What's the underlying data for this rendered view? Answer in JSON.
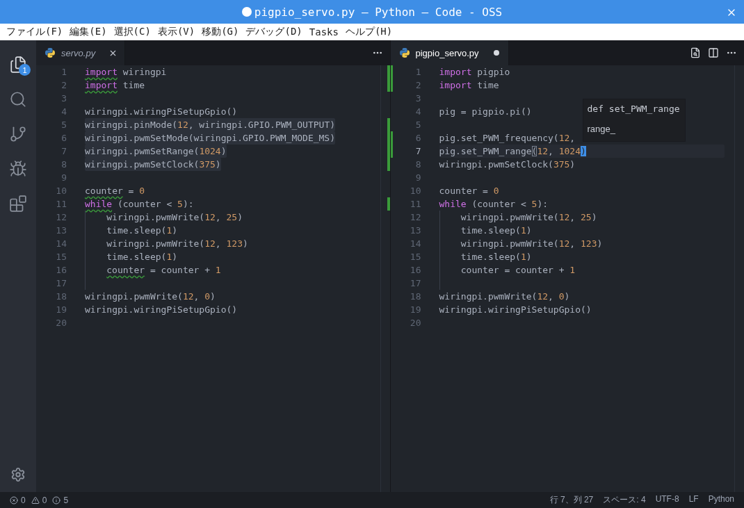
{
  "window": {
    "title": "pigpio_servo.py — Python — Code - OSS",
    "modified": true
  },
  "menu": [
    "ファイル(F)",
    "編集(E)",
    "選択(C)",
    "表示(V)",
    "移動(G)",
    "デバッグ(D)",
    "Tasks",
    "ヘルプ(H)"
  ],
  "activity_bar": {
    "items": [
      {
        "kind": "files",
        "selected": true,
        "badge": "1"
      },
      {
        "kind": "search",
        "selected": false
      },
      {
        "kind": "git",
        "selected": false
      },
      {
        "kind": "debug",
        "selected": false
      },
      {
        "kind": "extensions",
        "selected": false
      }
    ]
  },
  "editors": [
    {
      "active": false,
      "tab": {
        "label": "servo.py",
        "preview": true,
        "dirty": false
      },
      "actions": [
        {
          "kind": "more"
        }
      ],
      "lines": [
        {
          "n": "1",
          "changed": true,
          "tokens": [
            {
              "t": "import",
              "kind": "kw",
              "squiggle": true
            },
            {
              "t": " wiringpi",
              "kind": "id"
            }
          ]
        },
        {
          "n": "2",
          "changed": true,
          "tokens": [
            {
              "t": "import",
              "kind": "kw",
              "squiggle": true
            },
            {
              "t": " time",
              "kind": "id"
            }
          ]
        },
        {
          "n": "3"
        },
        {
          "n": "4",
          "tokens": [
            {
              "t": "wiringpi.wiringPiSetupGpio()",
              "kind": "id"
            }
          ]
        },
        {
          "n": "5",
          "changed": true,
          "highlighted": true,
          "tokens": [
            {
              "t": "wiringpi.pinMode(",
              "kind": "id"
            },
            {
              "t": "12",
              "kind": "num"
            },
            {
              "t": ", wiringpi.GPIO.PWM_OUTPUT)",
              "kind": "id"
            }
          ]
        },
        {
          "n": "6",
          "changed": true,
          "highlighted": true,
          "tokens": [
            {
              "t": "wiringpi.pwmSetMode(wiringpi.GPIO.PWM_MODE_MS)",
              "kind": "id"
            }
          ]
        },
        {
          "n": "7",
          "changed": true,
          "highlighted": true,
          "tokens": [
            {
              "t": "wiringpi.pwmSetRange(",
              "kind": "id"
            },
            {
              "t": "1024",
              "kind": "num"
            },
            {
              "t": ")",
              "kind": "id"
            }
          ]
        },
        {
          "n": "8",
          "changed": true,
          "highlighted": true,
          "tokens": [
            {
              "t": "wiringpi.pwmSetClock(",
              "kind": "id"
            },
            {
              "t": "375",
              "kind": "num"
            },
            {
              "t": ")",
              "kind": "id"
            }
          ]
        },
        {
          "n": "9"
        },
        {
          "n": "10",
          "tokens": [
            {
              "t": "counter",
              "kind": "id",
              "squiggle": true
            },
            {
              "t": " = ",
              "kind": "id"
            },
            {
              "t": "0",
              "kind": "num"
            }
          ]
        },
        {
          "n": "11",
          "changed": true,
          "tokens": [
            {
              "t": "while",
              "kind": "kw",
              "squiggle": true
            },
            {
              "t": " (counter < ",
              "kind": "id"
            },
            {
              "t": "5",
              "kind": "num"
            },
            {
              "t": "):",
              "kind": "id"
            }
          ]
        },
        {
          "n": "12",
          "indented": true,
          "tokens": [
            {
              "t": "wiringpi.pwmWrite(",
              "kind": "id"
            },
            {
              "t": "12",
              "kind": "num"
            },
            {
              "t": ", ",
              "kind": "id"
            },
            {
              "t": "25",
              "kind": "num"
            },
            {
              "t": ")",
              "kind": "id"
            }
          ]
        },
        {
          "n": "13",
          "indented": true,
          "tokens": [
            {
              "t": "time.sleep(",
              "kind": "id"
            },
            {
              "t": "1",
              "kind": "num"
            },
            {
              "t": ")",
              "kind": "id"
            }
          ]
        },
        {
          "n": "14",
          "indented": true,
          "tokens": [
            {
              "t": "wiringpi.pwmWrite(",
              "kind": "id"
            },
            {
              "t": "12",
              "kind": "num"
            },
            {
              "t": ", ",
              "kind": "id"
            },
            {
              "t": "123",
              "kind": "num"
            },
            {
              "t": ")",
              "kind": "id"
            }
          ]
        },
        {
          "n": "15",
          "indented": true,
          "tokens": [
            {
              "t": "time.sleep(",
              "kind": "id"
            },
            {
              "t": "1",
              "kind": "num"
            },
            {
              "t": ")",
              "kind": "id"
            }
          ]
        },
        {
          "n": "16",
          "indented": true,
          "tokens": [
            {
              "t": "counter",
              "kind": "id",
              "squiggle": true
            },
            {
              "t": " = counter + ",
              "kind": "id"
            },
            {
              "t": "1",
              "kind": "num"
            }
          ]
        },
        {
          "n": "17",
          "indented": true
        },
        {
          "n": "18",
          "tokens": [
            {
              "t": "wiringpi.pwmWrite(",
              "kind": "id"
            },
            {
              "t": "12",
              "kind": "num"
            },
            {
              "t": ", ",
              "kind": "id"
            },
            {
              "t": "0",
              "kind": "num"
            },
            {
              "t": ")",
              "kind": "id"
            }
          ]
        },
        {
          "n": "19",
          "tokens": [
            {
              "t": "wiringpi.wiringPiSetupGpio()",
              "kind": "id"
            }
          ]
        },
        {
          "n": "20"
        }
      ]
    },
    {
      "active": true,
      "tab": {
        "label": "pigpio_servo.py",
        "preview": false,
        "dirty": true
      },
      "actions": [
        {
          "kind": "changes"
        },
        {
          "kind": "split"
        },
        {
          "kind": "more"
        }
      ],
      "hover": {
        "signature": "def set_PWM_range",
        "doc": "range_"
      },
      "lines": [
        {
          "n": "1",
          "changed": true,
          "tokens": [
            {
              "t": "import",
              "kind": "kw"
            },
            {
              "t": " pigpio",
              "kind": "id"
            }
          ]
        },
        {
          "n": "2",
          "changed": true,
          "tokens": [
            {
              "t": "import",
              "kind": "kw"
            },
            {
              "t": " time",
              "kind": "id"
            }
          ]
        },
        {
          "n": "3"
        },
        {
          "n": "4",
          "tokens": [
            {
              "t": "pig = pigpio.pi()",
              "kind": "id"
            }
          ]
        },
        {
          "n": "5"
        },
        {
          "n": "6",
          "changed": true,
          "tokens": [
            {
              "t": "pig.set_PWM_frequency(",
              "kind": "id"
            },
            {
              "t": "12",
              "kind": "num"
            },
            {
              "t": ",",
              "kind": "id"
            }
          ]
        },
        {
          "n": "7",
          "changed": true,
          "current": true,
          "tokens": [
            {
              "t": "pig.set_PWM_range",
              "kind": "id"
            },
            {
              "t": "(",
              "kind": "id",
              "matched": true
            },
            {
              "t": "12",
              "kind": "num"
            },
            {
              "t": ", ",
              "kind": "id"
            },
            {
              "t": "1024",
              "kind": "num"
            },
            {
              "t": ")",
              "kind": "id",
              "cursor": true
            }
          ]
        },
        {
          "n": "8",
          "tokens": [
            {
              "t": "wiringpi.pwmSetClock(",
              "kind": "id"
            },
            {
              "t": "375",
              "kind": "num"
            },
            {
              "t": ")",
              "kind": "id"
            }
          ]
        },
        {
          "n": "9"
        },
        {
          "n": "10",
          "tokens": [
            {
              "t": "counter = ",
              "kind": "id"
            },
            {
              "t": "0",
              "kind": "num"
            }
          ]
        },
        {
          "n": "11",
          "tokens": [
            {
              "t": "while",
              "kind": "kw"
            },
            {
              "t": " (counter < ",
              "kind": "id"
            },
            {
              "t": "5",
              "kind": "num"
            },
            {
              "t": "):",
              "kind": "id"
            }
          ]
        },
        {
          "n": "12",
          "indented": true,
          "tokens": [
            {
              "t": "wiringpi.pwmWrite(",
              "kind": "id"
            },
            {
              "t": "12",
              "kind": "num"
            },
            {
              "t": ", ",
              "kind": "id"
            },
            {
              "t": "25",
              "kind": "num"
            },
            {
              "t": ")",
              "kind": "id"
            }
          ]
        },
        {
          "n": "13",
          "indented": true,
          "tokens": [
            {
              "t": "time.sleep(",
              "kind": "id"
            },
            {
              "t": "1",
              "kind": "num"
            },
            {
              "t": ")",
              "kind": "id"
            }
          ]
        },
        {
          "n": "14",
          "indented": true,
          "tokens": [
            {
              "t": "wiringpi.pwmWrite(",
              "kind": "id"
            },
            {
              "t": "12",
              "kind": "num"
            },
            {
              "t": ", ",
              "kind": "id"
            },
            {
              "t": "123",
              "kind": "num"
            },
            {
              "t": ")",
              "kind": "id"
            }
          ]
        },
        {
          "n": "15",
          "indented": true,
          "tokens": [
            {
              "t": "time.sleep(",
              "kind": "id"
            },
            {
              "t": "1",
              "kind": "num"
            },
            {
              "t": ")",
              "kind": "id"
            }
          ]
        },
        {
          "n": "16",
          "indented": true,
          "tokens": [
            {
              "t": "counter = counter + ",
              "kind": "id"
            },
            {
              "t": "1",
              "kind": "num"
            }
          ]
        },
        {
          "n": "17",
          "indented": true
        },
        {
          "n": "18",
          "tokens": [
            {
              "t": "wiringpi.pwmWrite(",
              "kind": "id"
            },
            {
              "t": "12",
              "kind": "num"
            },
            {
              "t": ", ",
              "kind": "id"
            },
            {
              "t": "0",
              "kind": "num"
            },
            {
              "t": ")",
              "kind": "id"
            }
          ]
        },
        {
          "n": "19",
          "tokens": [
            {
              "t": "wiringpi.wiringPiSetupGpio()",
              "kind": "id"
            }
          ]
        },
        {
          "n": "20"
        }
      ]
    }
  ],
  "status_bar": {
    "errors": "0",
    "warnings": "0",
    "infos": "5",
    "items": [
      "行 7、列 27",
      "スペース: 4",
      "UTF-8",
      "LF",
      "Python"
    ]
  }
}
